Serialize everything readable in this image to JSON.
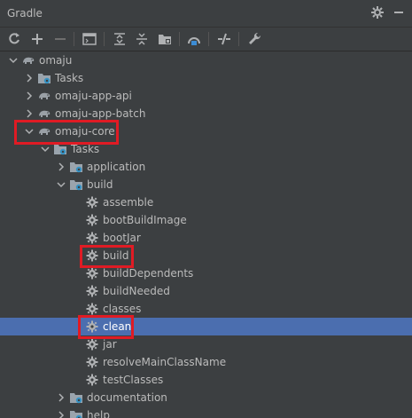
{
  "window": {
    "title": "Gradle"
  },
  "toolbar": {
    "items": [
      {
        "name": "refresh-icon"
      },
      {
        "name": "add-icon"
      },
      {
        "name": "remove-icon"
      },
      {
        "name": "run-task-icon"
      },
      {
        "name": "expand-all-icon"
      },
      {
        "name": "collapse-all-icon"
      },
      {
        "name": "group-tasks-icon"
      },
      {
        "name": "analyze-dependencies-icon"
      },
      {
        "name": "toggle-offline-icon"
      },
      {
        "name": "build-settings-icon"
      }
    ]
  },
  "tree": {
    "items": [
      {
        "label": "omaju",
        "icon": "elephant",
        "arrow": "down"
      },
      {
        "label": "Tasks",
        "icon": "folder-gear",
        "arrow": "right"
      },
      {
        "label": "omaju-app-api",
        "icon": "elephant",
        "arrow": "right"
      },
      {
        "label": "omaju-app-batch",
        "icon": "elephant",
        "arrow": "right"
      },
      {
        "label": "omaju-core",
        "icon": "elephant",
        "arrow": "down"
      },
      {
        "label": "Tasks",
        "icon": "folder-gear",
        "arrow": "down"
      },
      {
        "label": "application",
        "icon": "folder-gear",
        "arrow": "right"
      },
      {
        "label": "build",
        "icon": "folder-gear",
        "arrow": "down"
      },
      {
        "label": "assemble",
        "icon": "gear",
        "arrow": ""
      },
      {
        "label": "bootBuildImage",
        "icon": "gear",
        "arrow": ""
      },
      {
        "label": "bootJar",
        "icon": "gear",
        "arrow": ""
      },
      {
        "label": "build",
        "icon": "gear",
        "arrow": ""
      },
      {
        "label": "buildDependents",
        "icon": "gear",
        "arrow": ""
      },
      {
        "label": "buildNeeded",
        "icon": "gear",
        "arrow": ""
      },
      {
        "label": "classes",
        "icon": "gear",
        "arrow": ""
      },
      {
        "label": "clean",
        "icon": "gear",
        "arrow": ""
      },
      {
        "label": "jar",
        "icon": "gear",
        "arrow": ""
      },
      {
        "label": "resolveMainClassName",
        "icon": "gear",
        "arrow": ""
      },
      {
        "label": "testClasses",
        "icon": "gear",
        "arrow": ""
      },
      {
        "label": "documentation",
        "icon": "folder-gear",
        "arrow": "right"
      },
      {
        "label": "help",
        "icon": "folder-gear",
        "arrow": "right"
      }
    ],
    "selected": "clean"
  },
  "colors": {
    "background": "#3c3f41",
    "selection": "#4b6eaf",
    "highlight": "#e01b24"
  }
}
